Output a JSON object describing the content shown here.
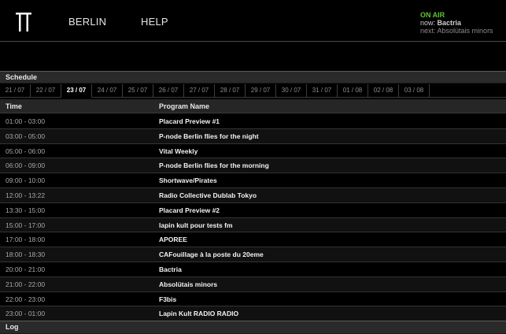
{
  "header": {
    "nav": {
      "berlin": "BERLIN",
      "help": "HELP"
    },
    "on_air": {
      "title": "ON AIR",
      "now_label": "now:",
      "now_value": "Bactria",
      "next_label": "next:",
      "next_value": "Absolütais minors"
    },
    "accent_color": "#5fc42c"
  },
  "schedule": {
    "title": "Schedule",
    "tabs": [
      "21 / 07",
      "22 / 07",
      "23 / 07",
      "24 / 07",
      "25 / 07",
      "26 / 07",
      "27 / 07",
      "28 / 07",
      "29 / 07",
      "30 / 07",
      "31 / 07",
      "01 / 08",
      "02 / 08",
      "03 / 08"
    ],
    "active_tab": "23 / 07",
    "columns": {
      "time": "Time",
      "program": "Program Name"
    },
    "rows": [
      {
        "time": "01:00 - 03:00",
        "program": "Placard Preview #1"
      },
      {
        "time": "03:00 - 05:00",
        "program": "P-node Berlin flies for the night"
      },
      {
        "time": "05:00 - 06:00",
        "program": "Vital Weekly"
      },
      {
        "time": "06:00 - 09:00",
        "program": "P-node Berlin flies for the morning"
      },
      {
        "time": "09:00 - 10:00",
        "program": "Shortwave/Pirates"
      },
      {
        "time": "12:00 - 13:22",
        "program": "Radio Collective Dublab Tokyo"
      },
      {
        "time": "13:30 - 15:00",
        "program": "Placard Preview #2"
      },
      {
        "time": "15:00 - 17:00",
        "program": "lapin kult pour tests fm"
      },
      {
        "time": "17:00 - 18:00",
        "program": "APOREE"
      },
      {
        "time": "18:00 - 18:30",
        "program": "CAFouillage à la poste du 20eme"
      },
      {
        "time": "20:00 - 21:00",
        "program": "Bactria"
      },
      {
        "time": "21:00 - 22:00",
        "program": "Absolütais minors"
      },
      {
        "time": "22:00 - 23:00",
        "program": "F3bis"
      },
      {
        "time": "23:00 - 01:00",
        "program": "Lapin Kult RADIO RADIO"
      }
    ]
  },
  "log": {
    "title": "Log"
  }
}
